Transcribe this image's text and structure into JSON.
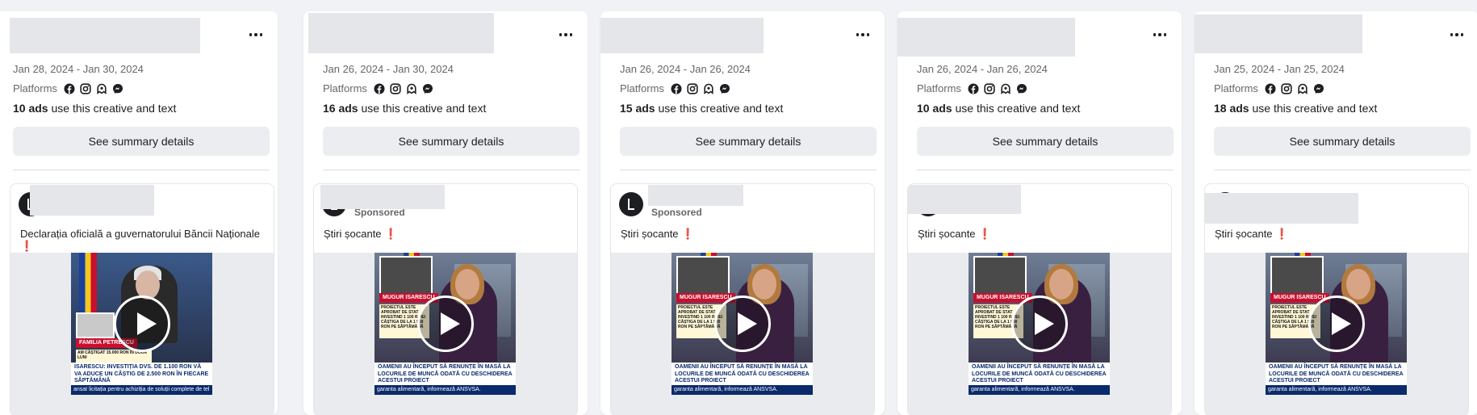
{
  "colors": {
    "page_bg": "#f0f2f5",
    "card_bg": "#ffffff",
    "button_bg": "#ebedf0",
    "alert_red": "#e41e3f"
  },
  "common": {
    "platforms_label": "Platforms",
    "ads_suffix": "use this creative and text",
    "summary_button_label": "See summary details",
    "sponsored_label": "Sponsored",
    "platform_icons": [
      "facebook-icon",
      "instagram-icon",
      "audience-network-icon",
      "messenger-icon"
    ],
    "exclamation": "❗"
  },
  "cards": [
    {
      "date_range": "Jan 28, 2024 - Jan 30, 2024",
      "ads_count": "10 ads",
      "ad_text": "Declarația oficială a guvernatorului Băncii Naționale",
      "video": {
        "name_tag": "FAMILIA PETRESCU",
        "box_text": "AM CÂȘTIGAT 15.000 RON ÎN DOUĂ LUNI",
        "headline": "ISARESCU: INVESTIȚIA DVS. DE 1.100 RON VĂ VA ADUCE UN CÂȘTIG DE 2.500 RON ÎN FIECARE SĂPTĂMÂNĂ",
        "ticker": "ansat licitația pentru achiziția de soluții complete de tel"
      }
    },
    {
      "date_range": "Jan 26, 2024 - Jan 30, 2024",
      "ads_count": "16 ads",
      "ad_text": "Știri șocante",
      "video": {
        "name_tag": "MUGUR ISARESCU",
        "box_text": "PROIECTUL ESTE APROBAT DE STAT INVESTIND 1 100 R VEI CÂȘTIGA DE LA 1 900 RON PE SĂPTĂMÂNĂ",
        "headline": "OAMENII AU ÎNCEPUT SĂ RENUNȚE ÎN MASĂ LA LOCURILE DE MUNCĂ ODATĂ CU DESCHIDEREA ACESTUI PROIECT",
        "ticker": "garanta alimentară, informează ANSVSA."
      }
    },
    {
      "date_range": "Jan 26, 2024 - Jan 26, 2024",
      "ads_count": "15 ads",
      "ad_text": "Știri șocante",
      "video": {
        "name_tag": "MUGUR ISARESCU",
        "box_text": "PROIECTUL ESTE APROBAT DE STAT INVESTIND 1 100 R VEI CÂȘTIGA DE LA 1 900 RON PE SĂPTĂMÂNĂ",
        "headline": "OAMENII AU ÎNCEPUT SĂ RENUNȚE ÎN MASĂ LA LOCURILE DE MUNCĂ ODATĂ CU DESCHIDEREA ACESTUI PROIECT",
        "ticker": "garanta alimentară, informează ANSVSA."
      }
    },
    {
      "date_range": "Jan 26, 2024 - Jan 26, 2024",
      "ads_count": "10 ads",
      "ad_text": "Știri șocante",
      "video": {
        "name_tag": "MUGUR ISARESCU",
        "box_text": "PROIECTUL ESTE APROBAT DE STAT INVESTIND 1 100 R VEI CÂȘTIGA DE LA 1 900 RON PE SĂPTĂMÂNĂ",
        "headline": "OAMENII AU ÎNCEPUT SĂ RENUNȚE ÎN MASĂ LA LOCURILE DE MUNCĂ ODATĂ CU DESCHIDEREA ACESTUI PROIECT",
        "ticker": "garanta alimentară, informează ANSVSA."
      }
    },
    {
      "date_range": "Jan 25, 2024 - Jan 25, 2024",
      "ads_count": "18 ads",
      "ad_text": "Știri șocante",
      "video": {
        "name_tag": "MUGUR ISARESCU",
        "box_text": "PROIECTUL ESTE APROBAT DE STAT INVESTIND 1 100 R VEI CÂȘTIGA DE LA 1 900 RON PE SĂPTĂMÂNĂ",
        "headline": "OAMENII AU ÎNCEPUT SĂ RENUNȚE ÎN MASĂ LA LOCURILE DE MUNCĂ ODATĂ CU DESCHIDEREA ACESTUI PROIECT",
        "ticker": "garanta alimentară, informează ANSVSA."
      }
    }
  ]
}
